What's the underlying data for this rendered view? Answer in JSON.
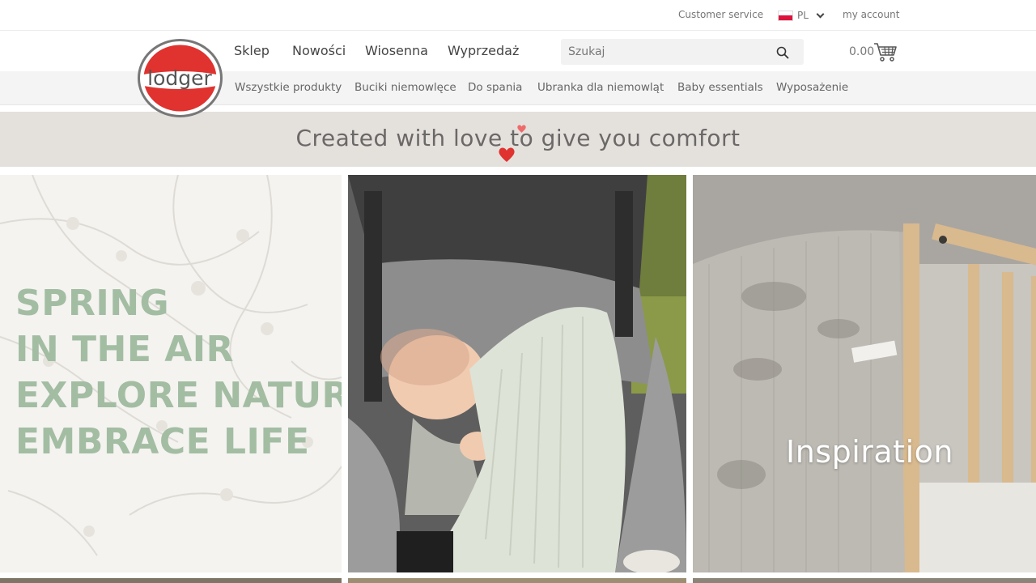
{
  "topbar": {
    "customer_service": "Customer service",
    "language": "PL",
    "my_account": "my account"
  },
  "brand": {
    "logo_text": "lodger"
  },
  "main_nav": [
    "Sklep",
    "Nowości",
    "Wiosenna",
    "Wyprzedaż"
  ],
  "search": {
    "placeholder": "Szukaj",
    "icon": "search-icon"
  },
  "cart": {
    "total": "0.00",
    "icon": "cart-icon"
  },
  "sub_nav": [
    "Wszystkie produkty",
    "Buciki niemowlęce",
    "Do spania",
    "Ubranka dla niemowląt",
    "Baby essentials",
    "Wyposażenie"
  ],
  "banner": {
    "tagline": "Created with love to give you comfort"
  },
  "tiles": {
    "spring_lines": [
      "SPRING",
      "IN THE AIR",
      "EXPLORE NATURE",
      "EMBRACE LIFE"
    ],
    "inspiration": "Inspiration"
  },
  "colors": {
    "brand_red": "#e0322f",
    "spring_green": "#a3bda3",
    "banner_bg": "#e4e1dd"
  }
}
